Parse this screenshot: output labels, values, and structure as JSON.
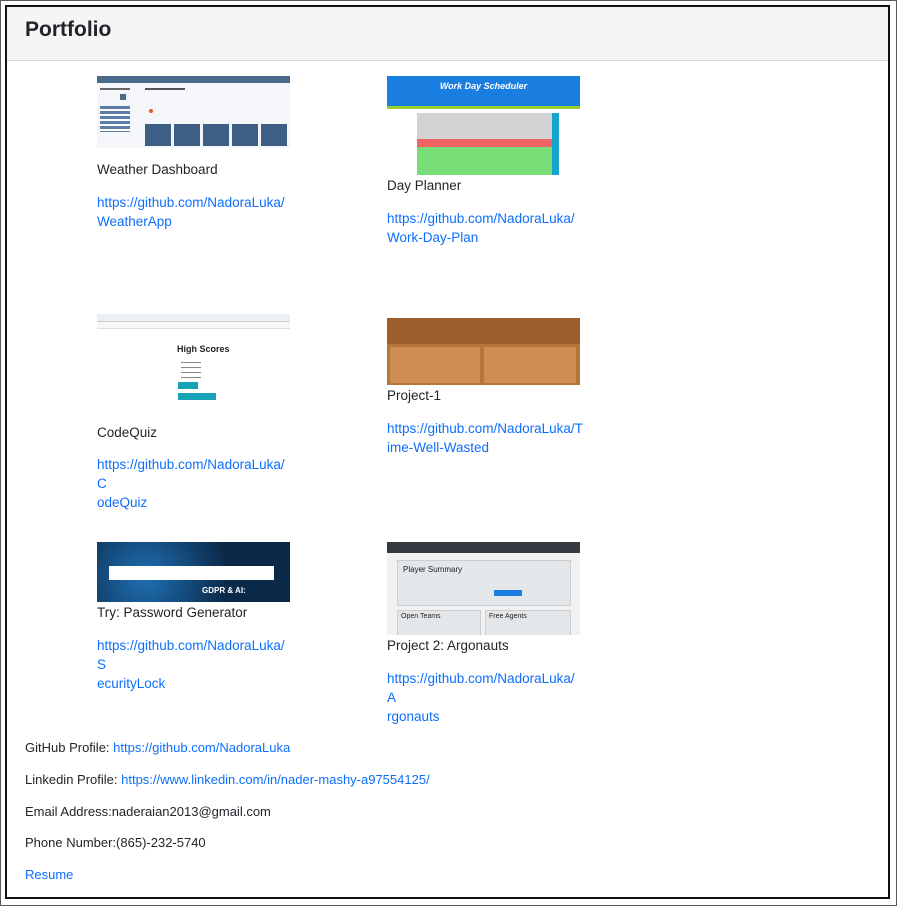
{
  "header": {
    "title": "Portfolio"
  },
  "projects": [
    {
      "title": "Weather Dashboard",
      "link": "https://github.com/NadoraLuka/WeatherApp",
      "link_line1": "https://github.com/NadoraLuka/",
      "link_line2": "WeatherApp"
    },
    {
      "title": "Day Planner",
      "link": "https://github.com/NadoraLuka/Work-Day-Plan",
      "link_line1": "https://github.com/NadoraLuka/",
      "link_line2": "Work-Day-Plan",
      "thumb_title": "Work Day Scheduler"
    },
    {
      "title": "CodeQuiz",
      "link": "https://github.com/NadoraLuka/CodeQuiz",
      "link_line1": "https://github.com/NadoraLuka/C",
      "link_line2": "odeQuiz",
      "thumb_title": "High Scores"
    },
    {
      "title": "Project-1",
      "link": "https://github.com/NadoraLuka/Time-Well-Wasted",
      "link_line1": "https://github.com/NadoraLuka/T",
      "link_line2": "ime-Well-Wasted"
    },
    {
      "title": "Try: Password Generator",
      "link": "https://github.com/NadoraLuka/SecurityLock",
      "link_line1": "https://github.com/NadoraLuka/S",
      "link_line2": "ecurityLock",
      "thumb_title": "GDPR & AI:"
    },
    {
      "title": "Project 2: Argonauts",
      "link": "https://github.com/NadoraLuka/Argonauts",
      "link_line1": "https://github.com/NadoraLuka/A",
      "link_line2": "rgonauts",
      "thumb_title": "Player Summary",
      "thumb_left": "Open Teams",
      "thumb_right": "Free Agents"
    }
  ],
  "contact": {
    "github_label": "GitHub Profile: ",
    "github_url": "https://github.com/NadoraLuka",
    "linkedin_label": "Linkedin Profile: ",
    "linkedin_url": "https://www.linkedin.com/in/nader-mashy-a97554125/",
    "email": "Email Address:naderaian2013@gmail.com",
    "phone": "Phone Number:(865)-232-5740",
    "resume": "Resume"
  }
}
